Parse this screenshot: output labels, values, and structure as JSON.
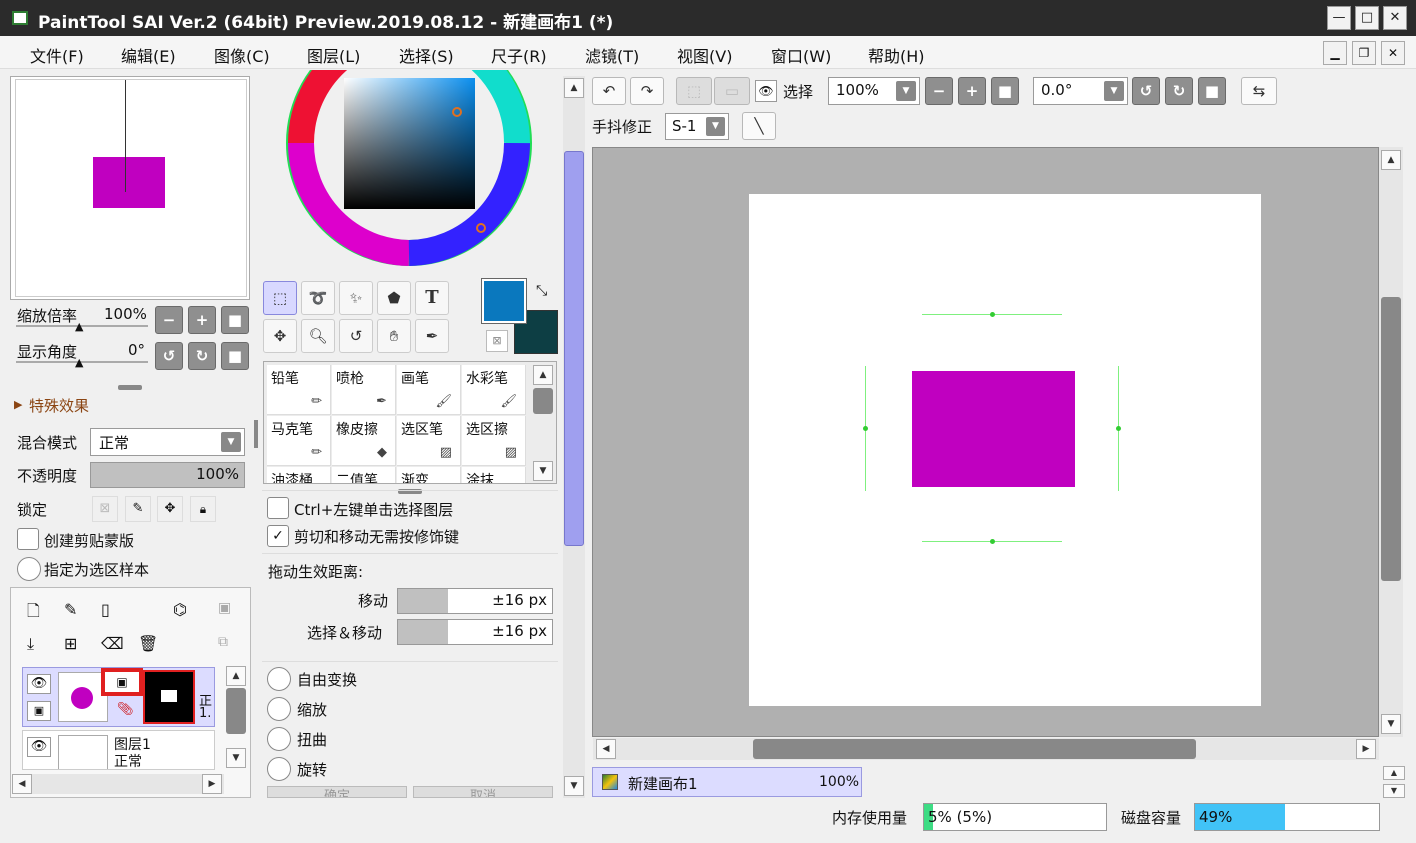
{
  "window": {
    "title": "PaintTool SAI Ver.2 (64bit) Preview.2019.08.12 - 新建画布1 (*)"
  },
  "menu": [
    "文件(F)",
    "编辑(E)",
    "图像(C)",
    "图层(L)",
    "选择(S)",
    "尺子(R)",
    "滤镜(T)",
    "视图(V)",
    "窗口(W)",
    "帮助(H)"
  ],
  "navigator": {
    "zoom_label": "缩放倍率",
    "zoom_value": "100%",
    "angle_label": "显示角度",
    "angle_value": "0°"
  },
  "layer_props": {
    "special_effects": "特殊效果",
    "blend_label": "混合模式",
    "blend_value": "正常",
    "opacity_label": "不透明度",
    "opacity_value": "100%",
    "opacity_fill": 1.0,
    "lock_label": "锁定",
    "clip_label": "创建剪贴蒙版",
    "sample_label": "指定为选区样本"
  },
  "layers": [
    {
      "name": "",
      "mode_short": "正",
      "mode_num": "1.",
      "selected": true
    },
    {
      "name": "图层1",
      "mode": "正常",
      "selected": false
    }
  ],
  "colors": {
    "primary": "#0a78be",
    "secondary": "#0d3e44",
    "accent": "#c000c0",
    "selection": "#dcdcff"
  },
  "brushes": [
    "铅笔",
    "喷枪",
    "画笔",
    "水彩笔",
    "马克笔",
    "橡皮擦",
    "选区笔",
    "选区擦",
    "油漆桶",
    "二值笔",
    "渐变",
    "涂抹"
  ],
  "tool_options": {
    "ctrl_click": "Ctrl+左键单击选择图层",
    "cut_move": "剪切和移动无需按修饰键",
    "drag_distance": "拖动生效距离:",
    "move_label": "移动",
    "move_value": "±16 px",
    "selmove_label": "选择＆移动",
    "selmove_value": "±16 px",
    "free_transform": "自由变换",
    "scale": "缩放",
    "distort": "扭曲",
    "rotate": "旋转",
    "ok_button": "确定",
    "cancel_button": "取消"
  },
  "toolbar": {
    "select_label": "选择",
    "zoom_value": "100%",
    "angle_value": "0.0°",
    "stabilizer_label": "手抖修正",
    "stabilizer_value": "S-1"
  },
  "document_tab": {
    "name": "新建画布1",
    "zoom": "100%"
  },
  "status": {
    "memory_label": "内存使用量",
    "memory_value": "5% (5%)",
    "memory_fill": 0.05,
    "disk_label": "磁盘容量",
    "disk_value": "49%",
    "disk_fill": 0.49
  }
}
